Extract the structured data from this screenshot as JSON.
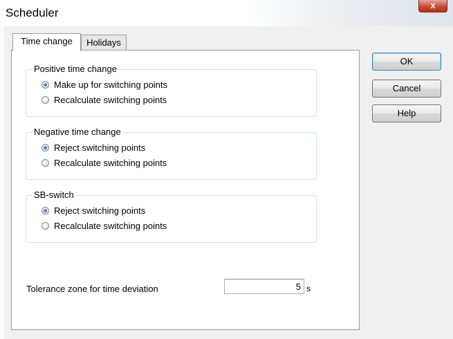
{
  "window": {
    "title": "Scheduler",
    "close_glyph": "x"
  },
  "tabs": [
    {
      "label": "Time change",
      "active": true
    },
    {
      "label": "Holidays",
      "active": false
    }
  ],
  "groups": [
    {
      "legend": "Positive time change",
      "options": [
        {
          "label": "Make up for switching points",
          "checked": true
        },
        {
          "label": "Recalculate switching points",
          "checked": false
        }
      ]
    },
    {
      "legend": "Negative time change",
      "options": [
        {
          "label": "Reject switching points",
          "checked": true
        },
        {
          "label": "Recalculate switching points",
          "checked": false
        }
      ]
    },
    {
      "legend": "SB-switch",
      "options": [
        {
          "label": "Reject switching points",
          "checked": true
        },
        {
          "label": "Recalculate switching points",
          "checked": false
        }
      ]
    }
  ],
  "tolerance": {
    "label": "Tolerance zone for time deviation",
    "value": "5",
    "unit": "s"
  },
  "buttons": {
    "ok": "OK",
    "cancel": "Cancel",
    "help": "Help"
  },
  "colors": {
    "accent": "#3c7fb1",
    "close_button": "#c8452f",
    "dialog_bg": "#f0f0f0"
  },
  "icons": {
    "close": "close-icon",
    "radio_checked": "radio-checked-icon",
    "radio_unchecked": "radio-unchecked-icon"
  }
}
